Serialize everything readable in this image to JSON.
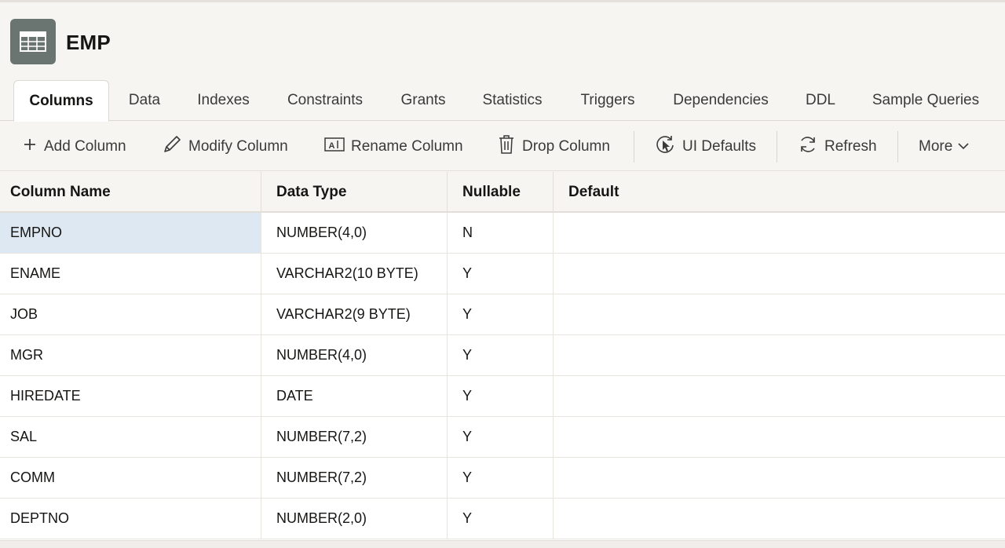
{
  "header": {
    "title": "EMP",
    "icon": "table-icon"
  },
  "tabs": [
    {
      "label": "Columns",
      "active": true
    },
    {
      "label": "Data"
    },
    {
      "label": "Indexes"
    },
    {
      "label": "Constraints"
    },
    {
      "label": "Grants"
    },
    {
      "label": "Statistics"
    },
    {
      "label": "Triggers"
    },
    {
      "label": "Dependencies"
    },
    {
      "label": "DDL"
    },
    {
      "label": "Sample Queries"
    }
  ],
  "toolbar": {
    "add_column": {
      "label": "Add Column",
      "icon": "plus-icon"
    },
    "modify_column": {
      "label": "Modify Column",
      "icon": "pencil-icon"
    },
    "rename_column": {
      "label": "Rename Column",
      "icon": "text-box-icon"
    },
    "drop_column": {
      "label": "Drop Column",
      "icon": "trash-icon"
    },
    "ui_defaults": {
      "label": "UI Defaults",
      "icon": "cursor-refresh-icon"
    },
    "refresh": {
      "label": "Refresh",
      "icon": "refresh-icon"
    },
    "more": {
      "label": "More",
      "icon": "chevron-down-icon"
    }
  },
  "table": {
    "headers": [
      "Column Name",
      "Data Type",
      "Nullable",
      "Default"
    ],
    "rows": [
      {
        "name": "EMPNO",
        "type": "NUMBER(4,0)",
        "nullable": "N",
        "default": "",
        "selected": true
      },
      {
        "name": "ENAME",
        "type": "VARCHAR2(10 BYTE)",
        "nullable": "Y",
        "default": ""
      },
      {
        "name": "JOB",
        "type": "VARCHAR2(9 BYTE)",
        "nullable": "Y",
        "default": ""
      },
      {
        "name": "MGR",
        "type": "NUMBER(4,0)",
        "nullable": "Y",
        "default": ""
      },
      {
        "name": "HIREDATE",
        "type": "DATE",
        "nullable": "Y",
        "default": ""
      },
      {
        "name": "SAL",
        "type": "NUMBER(7,2)",
        "nullable": "Y",
        "default": ""
      },
      {
        "name": "COMM",
        "type": "NUMBER(7,2)",
        "nullable": "Y",
        "default": ""
      },
      {
        "name": "DEPTNO",
        "type": "NUMBER(2,0)",
        "nullable": "Y",
        "default": ""
      }
    ]
  },
  "colors": {
    "selected_row": "#dde8f2",
    "icon_bg": "#6a7471"
  }
}
